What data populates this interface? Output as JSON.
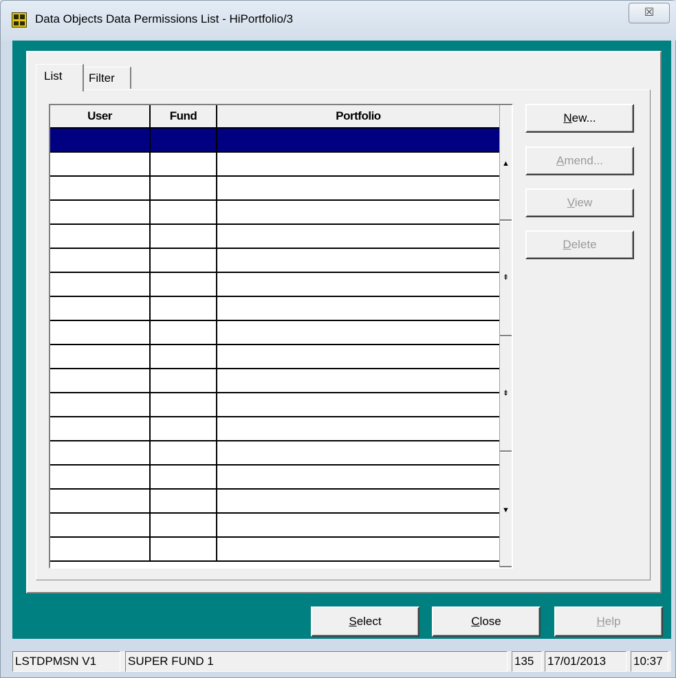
{
  "window": {
    "title": "Data Objects Data Permissions List - HiPortfolio/3",
    "close_glyph": "☒"
  },
  "tabs": [
    {
      "label": "List",
      "active": true
    },
    {
      "label": "Filter",
      "active": false
    }
  ],
  "grid": {
    "columns": [
      "User",
      "Fund",
      "Portfolio"
    ],
    "row_count": 18,
    "selected_row": 0
  },
  "scrollbar": {
    "glyphs": [
      "▲",
      "⇞",
      "⇟",
      "▼"
    ]
  },
  "side_buttons": {
    "new": {
      "label": "New...",
      "mnemonic": "N",
      "rest": "ew...",
      "enabled": true
    },
    "amend": {
      "label": "Amend...",
      "mnemonic": "A",
      "rest": "mend...",
      "enabled": false
    },
    "view": {
      "label": "View",
      "mnemonic": "V",
      "rest": "iew",
      "enabled": false
    },
    "delete": {
      "label": "Delete",
      "mnemonic": "D",
      "rest": "elete",
      "enabled": false
    }
  },
  "bottom_buttons": {
    "select": {
      "label": "Select",
      "mnemonic": "S",
      "rest": "elect",
      "enabled": true
    },
    "close": {
      "label": "Close",
      "mnemonic": "C",
      "rest": "lose",
      "enabled": true
    },
    "help": {
      "label": "Help",
      "mnemonic": "H",
      "rest": "elp",
      "enabled": false
    }
  },
  "status": {
    "form_id": "LSTDPMSN V1",
    "fund": "SUPER FUND 1",
    "count": "135",
    "date": "17/01/2013",
    "time": "10:37"
  },
  "colors": {
    "teal_background": "#008080",
    "selection": "#000080"
  }
}
